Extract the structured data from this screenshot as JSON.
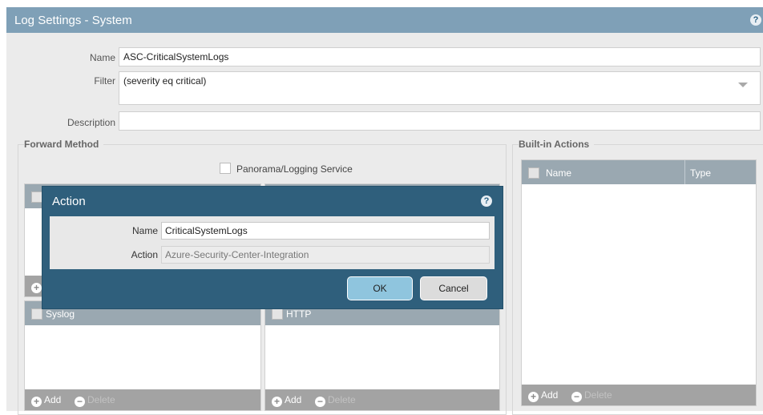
{
  "window": {
    "title": "Log Settings - System",
    "help_icon": "?"
  },
  "form": {
    "name_label": "Name",
    "name_value": "ASC-CriticalSystemLogs",
    "filter_label": "Filter",
    "filter_value": "(severity eq critical)",
    "description_label": "Description",
    "description_value": ""
  },
  "forward_method": {
    "title": "Forward Method",
    "panorama_label": "Panorama/Logging Service",
    "panels": [
      {
        "header": "Syslog",
        "add": "Add",
        "delete": "Delete"
      },
      {
        "header": "HTTP",
        "add": "Add",
        "delete": "Delete"
      }
    ]
  },
  "builtin_actions": {
    "title": "Built-in Actions",
    "col_name": "Name",
    "col_type": "Type",
    "add": "Add",
    "delete": "Delete"
  },
  "dialog": {
    "title": "Action",
    "help_icon": "?",
    "name_label": "Name",
    "name_value": "CriticalSystemLogs",
    "action_label": "Action",
    "action_value": "Azure-Security-Center-Integration",
    "ok_label": "OK",
    "cancel_label": "Cancel"
  }
}
